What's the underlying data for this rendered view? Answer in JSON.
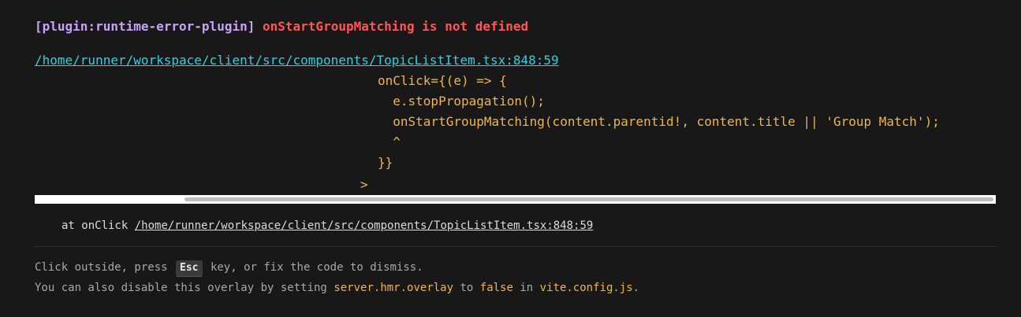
{
  "error": {
    "plugin": "[plugin:runtime-error-plugin]",
    "message": "onStartGroupMatching is not defined"
  },
  "file": {
    "location": "/home/runner/workspace/client/src/components/TopicListItem.tsx:848:59"
  },
  "frame": {
    "lines": [
      "onClick={(e) => {",
      "  e.stopPropagation();",
      "  onStartGroupMatching(content.parentid!, content.title || 'Group Match');",
      "  ^",
      "}}",
      ">"
    ]
  },
  "stack": {
    "prefix": "at onClick",
    "location": "/home/runner/workspace/client/src/components/TopicListItem.tsx:848:59"
  },
  "tips": {
    "line1_before": "Click outside, press",
    "key": "Esc",
    "line1_after": "key, or fix the code to dismiss.",
    "line2_before": "You can also disable this overlay by setting",
    "setting": "server.hmr.overlay",
    "line2_mid": "to",
    "value": "false",
    "line2_in": "in",
    "config_file": "vite.config.js",
    "line2_end": "."
  },
  "colors": {
    "background": "#181818",
    "plugin": "#c8a2f7",
    "error": "#ff5555",
    "link": "#2fd1e0",
    "code": "#f0b44c"
  }
}
